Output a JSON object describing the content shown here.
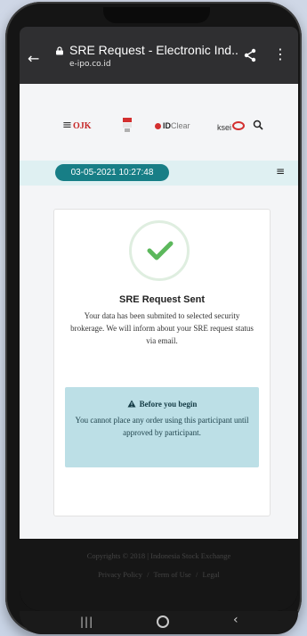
{
  "browser": {
    "back_icon": "arrow-left-icon",
    "lock_icon": "lock-icon",
    "title": "SRE Request - Electronic Ind...",
    "url": "e-ipo.co.id",
    "share_icon": "share-icon",
    "menu_icon": "more-vert-icon"
  },
  "header": {
    "menu_icon": "hamburger-icon",
    "logos": {
      "ojk": "OJK",
      "idclear_strong": "ID",
      "idclear_light": "Clear",
      "ksei": "ksei"
    },
    "search_icon": "search-icon"
  },
  "date_bar": {
    "datetime": "03-05-2021 10:27:48",
    "menu_icon": "hamburger-icon"
  },
  "card": {
    "check_icon": "checkmark-icon",
    "title": "SRE Request Sent",
    "message": "Your data has been submited to selected security brokerage. We will inform about your SRE request status via email.",
    "notice": {
      "warning_icon": "warning-icon",
      "title": "Before you begin",
      "body": "You cannot place any order using this participant until approved by participant."
    }
  },
  "footer": {
    "copyright": "Copyrights © 2018 | Indonesia Stock Exchange",
    "links": [
      "Privacy Policy",
      "Term of Use",
      "Legal"
    ],
    "separator": "/"
  },
  "system_nav": {
    "recent_icon": "recent-apps-icon",
    "home_icon": "home-icon",
    "back_icon": "back-icon"
  },
  "colors": {
    "accent": "#177e86",
    "strip": "#dff0f2",
    "notice_bg": "#bcdfe6",
    "check": "#5cb85c"
  }
}
